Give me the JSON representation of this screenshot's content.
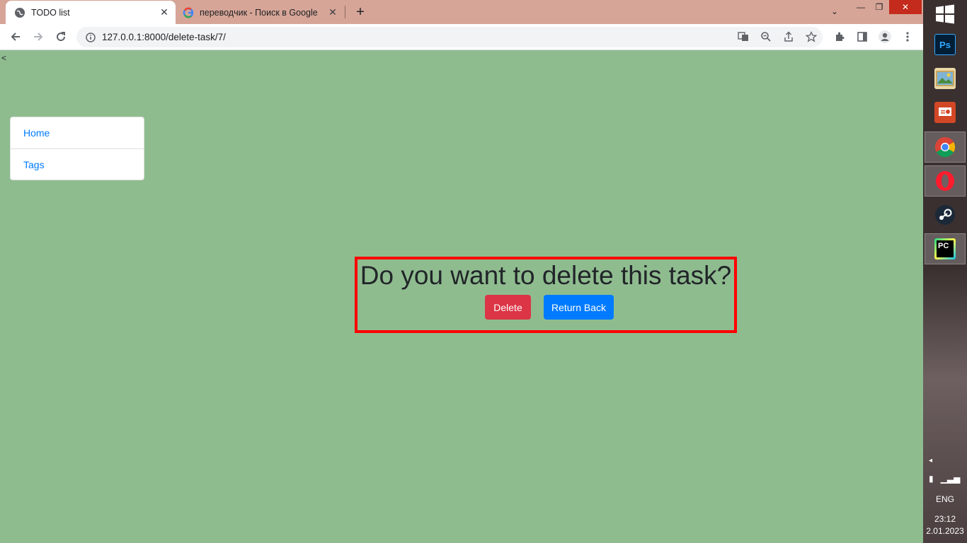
{
  "browser": {
    "tabs": [
      {
        "title": "TODO list",
        "active": true
      },
      {
        "title": "переводчик - Поиск в Google",
        "active": false
      }
    ],
    "url": "127.0.0.1:8000/delete-task/7/"
  },
  "page": {
    "stray_text": "<",
    "nav": [
      {
        "label": "Home"
      },
      {
        "label": "Tags"
      }
    ],
    "confirm": {
      "title": "Do you want to delete this task?",
      "delete_label": "Delete",
      "back_label": "Return Back"
    },
    "colors": {
      "background": "#8fbc8f",
      "delete": "#dc3545",
      "primary": "#007bff",
      "highlight_border": "#ff0000"
    }
  },
  "taskbar": {
    "apps": [
      {
        "name": "photoshop-icon",
        "label": "Ps",
        "running": false
      },
      {
        "name": "photos-icon",
        "label": "",
        "running": false
      },
      {
        "name": "powerpoint-icon",
        "label": "",
        "running": false
      },
      {
        "name": "chrome-icon",
        "label": "",
        "running": true
      },
      {
        "name": "opera-icon",
        "label": "",
        "running": true
      },
      {
        "name": "steam-icon",
        "label": "",
        "running": false
      },
      {
        "name": "pycharm-icon",
        "label": "PC",
        "running": true
      }
    ],
    "language": "ENG",
    "time": "23:12",
    "date": "2.01.2023"
  }
}
